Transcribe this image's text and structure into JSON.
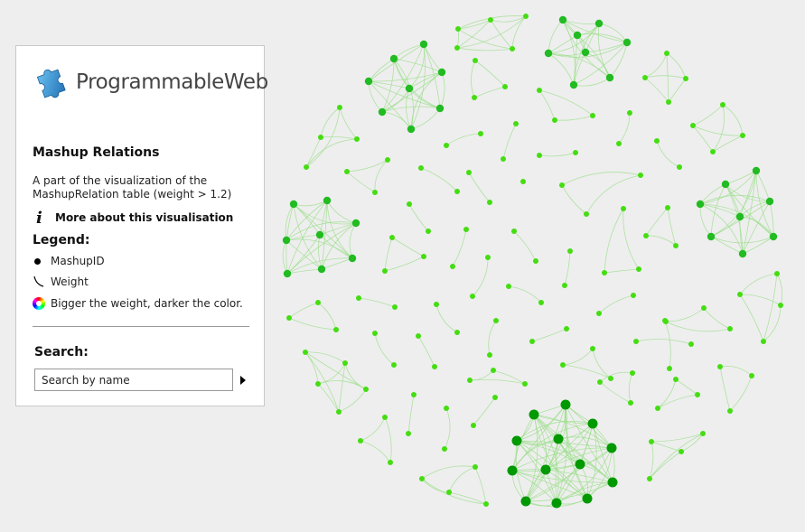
{
  "panel": {
    "logo_text": "ProgrammableWeb",
    "title": "Mashup Relations",
    "description": "A part of the visualization of the MashupRelation table (weight > 1.2)",
    "more_link": "More about this visualisation",
    "legend_title": "Legend:",
    "legend": [
      {
        "icon": "black-dot-icon",
        "label": "MashupID"
      },
      {
        "icon": "curve-line-icon",
        "label": "Weight"
      },
      {
        "icon": "color-wheel-icon",
        "label": "Bigger the weight, darker the color."
      }
    ],
    "search_title": "Search:",
    "search_placeholder": "Search by name"
  },
  "colors": {
    "background": "#eeeeee",
    "light_node": "#44dd11",
    "mid_node": "#22bb22",
    "dark_node": "#009900",
    "edge": "#99dd88"
  }
}
